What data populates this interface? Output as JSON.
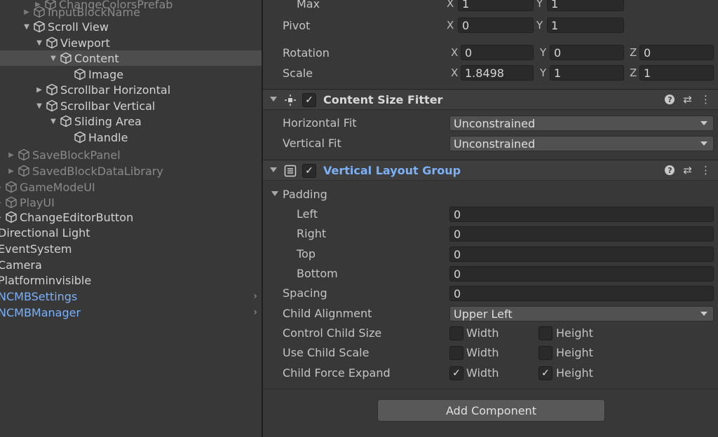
{
  "hierarchy": {
    "items": [
      {
        "label": "ChangeColorsPrefab",
        "expanded": false,
        "dim": true
      },
      {
        "label": "InputBlockName",
        "expanded": false,
        "dim": true
      },
      {
        "label": "Scroll View",
        "expanded": true
      },
      {
        "label": "Viewport",
        "expanded": true
      },
      {
        "label": "Content",
        "expanded": true,
        "selected": true
      },
      {
        "label": "Image"
      },
      {
        "label": "Scrollbar Horizontal",
        "expanded": false
      },
      {
        "label": "Scrollbar Vertical",
        "expanded": true
      },
      {
        "label": "Sliding Area",
        "expanded": true
      },
      {
        "label": "Handle"
      },
      {
        "label": "SaveBlockPanel",
        "expanded": false,
        "dim": true
      },
      {
        "label": "SavedBlockDataLibrary",
        "expanded": false,
        "dim": true
      },
      {
        "label": "GameModeUI",
        "expanded": false,
        "dim": true
      },
      {
        "label": "PlayUI",
        "expanded": false,
        "dim": true
      },
      {
        "label": "ChangeEditorButton",
        "expanded": false
      },
      {
        "label": "Directional Light"
      },
      {
        "label": "EventSystem"
      },
      {
        "label": "Camera"
      },
      {
        "label": "Platforminvisible"
      },
      {
        "label": "NCMBSettings",
        "blue": true,
        "chevron": "›"
      },
      {
        "label": "NCMBManager",
        "blue": true,
        "chevron": "›"
      }
    ]
  },
  "rect_transform": {
    "max_label": "Max",
    "max_x": "1",
    "max_y": "1",
    "pivot_label": "Pivot",
    "pivot_x": "0",
    "pivot_y": "1",
    "rotation_label": "Rotation",
    "rotation_x": "0",
    "rotation_y": "0",
    "rotation_z": "0",
    "scale_label": "Scale",
    "scale_x": "1.8498",
    "scale_y": "1",
    "scale_z": "1",
    "x_letter": "X",
    "y_letter": "Y",
    "z_letter": "Z"
  },
  "content_size_fitter": {
    "title": "Content Size Fitter",
    "enabled_mark": "✓",
    "horizontal_fit_label": "Horizontal Fit",
    "horizontal_fit_value": "Unconstrained",
    "vertical_fit_label": "Vertical Fit",
    "vertical_fit_value": "Unconstrained"
  },
  "vertical_layout_group": {
    "title": "Vertical Layout Group",
    "enabled_mark": "✓",
    "padding_label": "Padding",
    "left_label": "Left",
    "left_value": "0",
    "right_label": "Right",
    "right_value": "0",
    "top_label": "Top",
    "top_value": "0",
    "bottom_label": "Bottom",
    "bottom_value": "0",
    "spacing_label": "Spacing",
    "spacing_value": "0",
    "child_alignment_label": "Child Alignment",
    "child_alignment_value": "Upper Left",
    "control_child_size_label": "Control Child Size",
    "use_child_scale_label": "Use Child Scale",
    "child_force_expand_label": "Child Force Expand",
    "width_label": "Width",
    "height_label": "Height",
    "check_mark": "✓",
    "control_child_size_width": false,
    "control_child_size_height": false,
    "use_child_scale_width": false,
    "use_child_scale_height": false,
    "child_force_expand_width": true,
    "child_force_expand_height": true
  },
  "header_icons": {
    "help": "?",
    "presets": "⇄",
    "menu": "⋮"
  },
  "add_component_label": "Add Component",
  "colors": {
    "background": "#383838",
    "header": "#3e3e3e",
    "field": "#2a2a2a",
    "dropdown": "#515151",
    "selected_row": "#4d4d4d",
    "blue_text": "#7cb0f7"
  }
}
